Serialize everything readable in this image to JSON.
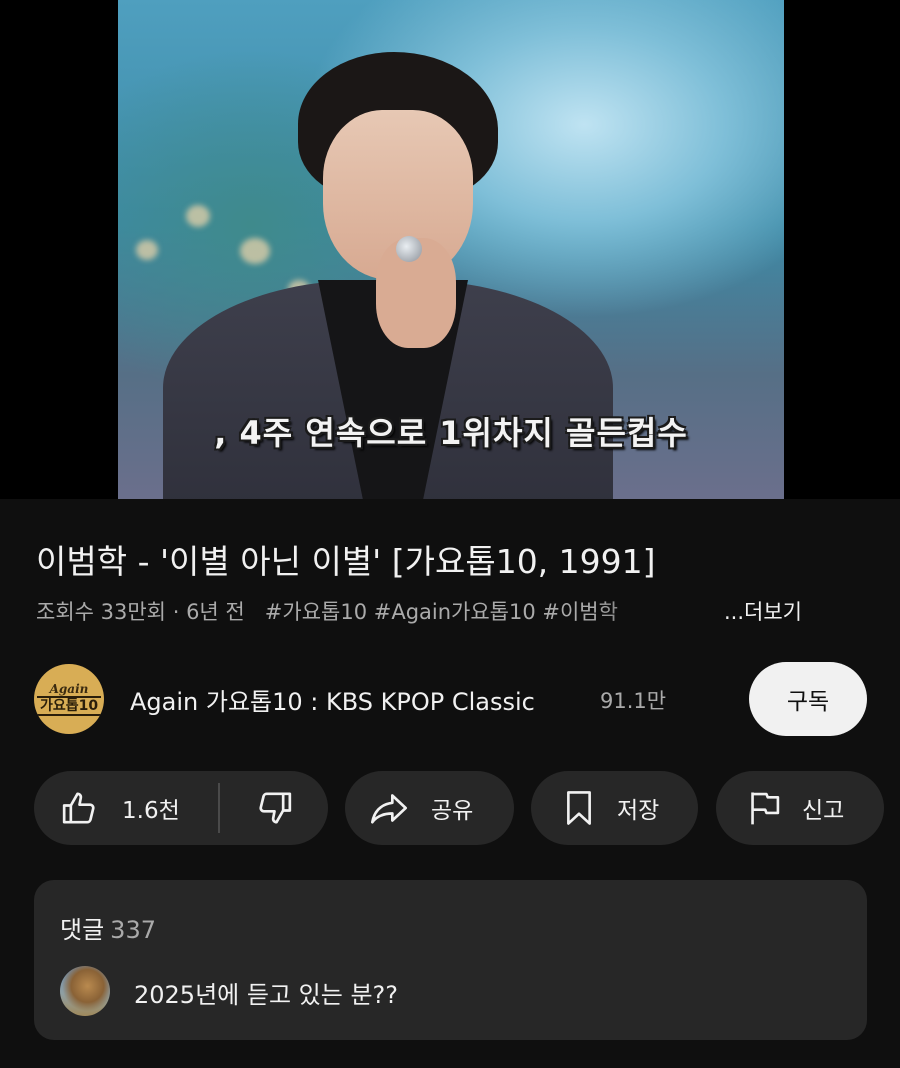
{
  "video": {
    "subtitle": ", 4주 연속으로 1위차지 골든컵수"
  },
  "title": "이범학 - '이별 아닌 이별' [가요톱10, 1991]",
  "meta": {
    "views": "조회수 33만회",
    "separator": "·",
    "age": "6년 전",
    "tags": "#가요톱10 #Again가요톱10 #이범학",
    "more": "...더보기"
  },
  "channel": {
    "logo_line1": "Again",
    "logo_line2": "가요톱10",
    "name": "Again 가요톱10 : KBS KPOP Classic",
    "subscribers": "91.1만",
    "subscribe_label": "구독"
  },
  "actions": {
    "like_count": "1.6천",
    "share_label": "공유",
    "save_label": "저장",
    "report_label": "신고"
  },
  "comments": {
    "header": "댓글",
    "count": "337",
    "top_comment": "2025년에 듣고 있는 분??"
  },
  "colors": {
    "background": "#0f0f0f",
    "pill": "#272727",
    "text_primary": "#f1f1f1",
    "text_secondary": "#aaaaaa",
    "subscribe_bg": "#f1f1f1"
  },
  "icons": {
    "like": "thumbs-up-icon",
    "dislike": "thumbs-down-icon",
    "share": "share-arrow-icon",
    "save": "bookmark-icon",
    "report": "flag-icon"
  }
}
